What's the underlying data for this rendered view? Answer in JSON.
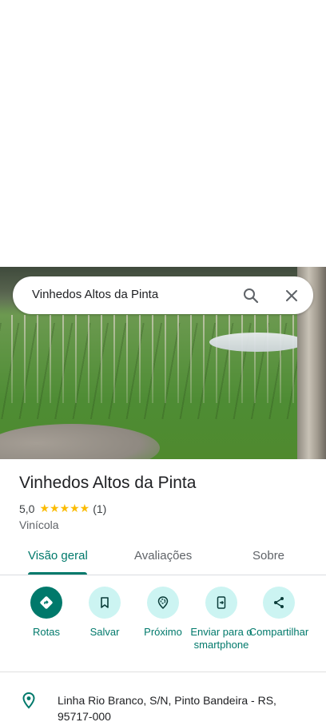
{
  "search": {
    "query": "Vinhedos Altos da Pinta"
  },
  "place": {
    "name": "Vinhedos Altos da Pinta",
    "rating": "5,0",
    "stars": "★★★★★",
    "review_count": "(1)",
    "category": "Vinícola"
  },
  "tabs": [
    {
      "label": "Visão geral",
      "active": true
    },
    {
      "label": "Avaliações",
      "active": false
    },
    {
      "label": "Sobre",
      "active": false
    }
  ],
  "actions": [
    {
      "label": "Rotas",
      "icon": "directions-icon"
    },
    {
      "label": "Salvar",
      "icon": "bookmark-icon"
    },
    {
      "label": "Próximo",
      "icon": "nearby-icon"
    },
    {
      "label": "Enviar para o smartphone",
      "icon": "send-to-phone-icon"
    },
    {
      "label": "Compartilhar",
      "icon": "share-icon"
    }
  ],
  "address": "Linha Rio Branco, S/N, Pinto Bandeira - RS, 95717-000",
  "colors": {
    "accent": "#00796b",
    "chip_bg": "#ccf4f2",
    "star": "#fbbc04"
  }
}
